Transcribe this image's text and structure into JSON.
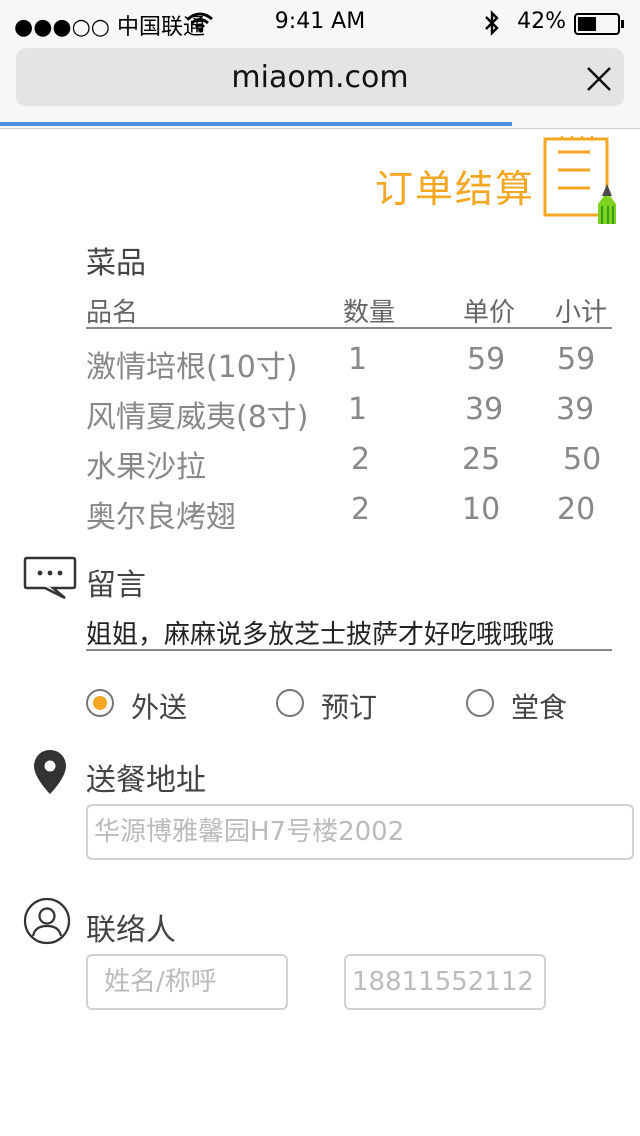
{
  "status_bar": {
    "carrier": "●●●○○ 中国联通",
    "time": "9:41 AM",
    "battery": "42%"
  },
  "browser": {
    "url": "miaom.com",
    "close_icon": "close-icon",
    "progress_percent": 80
  },
  "page": {
    "title": "订单结算",
    "title_color": "#f5a623",
    "dishes": {
      "section_title": "菜品",
      "columns": [
        "品名",
        "数量",
        "单价",
        "小计"
      ],
      "rows": [
        {
          "name": "激情培根(10寸)",
          "qty": "1",
          "price": "59",
          "subtotal": "59"
        },
        {
          "name": "风情夏威夷(8寸)",
          "qty": "1",
          "price": "39",
          "subtotal": "39"
        },
        {
          "name": "水果沙拉",
          "qty": "2",
          "price": "25",
          "subtotal": "50"
        },
        {
          "name": "奥尔良烤翅",
          "qty": "2",
          "price": "10",
          "subtotal": "20"
        }
      ]
    },
    "message": {
      "section_title": "留言",
      "value": "姐姐，麻麻说多放芝士披萨才好吃哦哦哦"
    },
    "order_type": {
      "options": [
        "外送",
        "预订",
        "堂食"
      ],
      "selected": "外送"
    },
    "address": {
      "section_title": "送餐地址",
      "placeholder": "华源博雅馨园H7号楼2002"
    },
    "contact": {
      "section_title": "联络人",
      "name_placeholder": "姓名/称呼",
      "phone_placeholder": "18811552112"
    }
  }
}
